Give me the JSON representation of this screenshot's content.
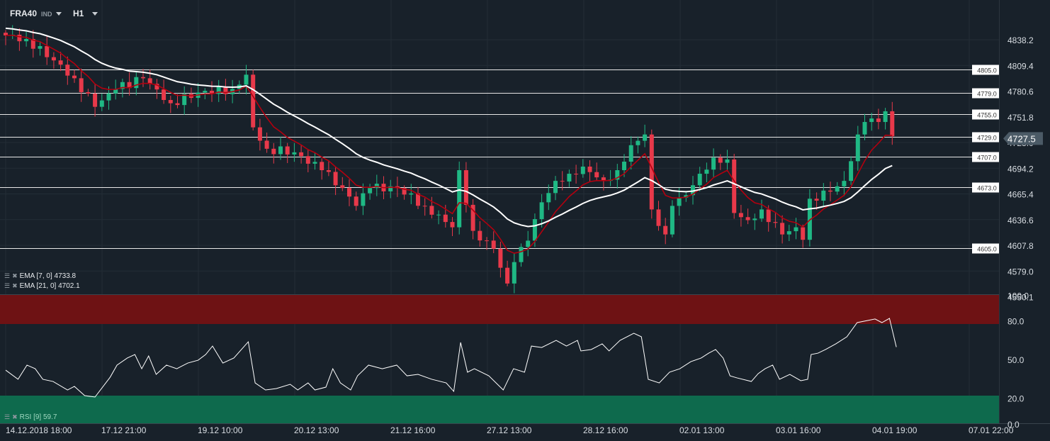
{
  "header": {
    "symbol": "FRA40",
    "type": "IND",
    "timeframe": "H1"
  },
  "indicators": {
    "ema7": "EMA [7, 0] 4733.8",
    "ema21": "EMA [21, 0] 4702.1",
    "rsi": "RSI [9] 59.7"
  },
  "colors": {
    "bg": "#18212a",
    "up": "#1fb884",
    "down": "#e8394a",
    "ema7": "#b3000f",
    "ema21": "#ffffff",
    "overbought": "#6e1214",
    "oversold": "#0e6a4d",
    "grid": "#232d36"
  },
  "chart_data": [
    {
      "type": "candlestick",
      "title": "FRA40 H1",
      "ylim": [
        4550.1,
        4845
      ],
      "y_ticks": [
        "4838.2",
        "4809.4",
        "4780.6",
        "4751.8",
        "4723.0",
        "4694.2",
        "4665.4",
        "4636.6",
        "4607.8",
        "4579.0",
        "4550.1"
      ],
      "x_ticks": [
        "14.12.2018  18:00",
        "17.12  21:00",
        "19.12  10:00",
        "20.12  13:00",
        "21.12  16:00",
        "27.12  13:00",
        "28.12  16:00",
        "02.01  13:00",
        "03.01  16:00",
        "04.01  19:00",
        "07.01  22:00"
      ],
      "current_price": "4727.5",
      "levels": [
        "4805.0",
        "4779.0",
        "4755.0",
        "4729.0",
        "4707.0",
        "4673.0",
        "4605.0"
      ],
      "candle_count": 130,
      "close_anchors": [
        [
          0,
          4843
        ],
        [
          3,
          4839
        ],
        [
          7,
          4815
        ],
        [
          10,
          4795
        ],
        [
          13,
          4763
        ],
        [
          16,
          4783
        ],
        [
          20,
          4795
        ],
        [
          24,
          4767
        ],
        [
          28,
          4779
        ],
        [
          33,
          4783
        ],
        [
          35,
          4799
        ],
        [
          36,
          4740
        ],
        [
          38,
          4716
        ],
        [
          42,
          4712
        ],
        [
          46,
          4692
        ],
        [
          49,
          4672
        ],
        [
          51,
          4652
        ],
        [
          53,
          4672
        ],
        [
          57,
          4672
        ],
        [
          61,
          4652
        ],
        [
          65,
          4628
        ],
        [
          66,
          4692
        ],
        [
          68,
          4624
        ],
        [
          71,
          4604
        ],
        [
          73,
          4565
        ],
        [
          74,
          4589
        ],
        [
          76,
          4613
        ],
        [
          78,
          4656
        ],
        [
          80,
          4680
        ],
        [
          82,
          4688
        ],
        [
          84,
          4696
        ],
        [
          87,
          4680
        ],
        [
          89,
          4692
        ],
        [
          91,
          4720
        ],
        [
          93,
          4732
        ],
        [
          94,
          4648
        ],
        [
          96,
          4620
        ],
        [
          97,
          4652
        ],
        [
          99,
          4664
        ],
        [
          101,
          4688
        ],
        [
          103,
          4706
        ],
        [
          105,
          4704
        ],
        [
          106,
          4644
        ],
        [
          108,
          4636
        ],
        [
          110,
          4648
        ],
        [
          113,
          4620
        ],
        [
          115,
          4628
        ],
        [
          116,
          4614
        ],
        [
          117,
          4660
        ],
        [
          120,
          4668
        ],
        [
          122,
          4680
        ],
        [
          124,
          4732
        ],
        [
          125,
          4746
        ],
        [
          127,
          4746
        ],
        [
          128,
          4758
        ],
        [
          129,
          4730
        ]
      ],
      "series": [
        {
          "name": "EMA 7",
          "period": 7
        },
        {
          "name": "EMA 21",
          "period": 21
        }
      ]
    },
    {
      "type": "line",
      "title": "RSI [9]",
      "ylim": [
        0,
        100
      ],
      "y_ticks": [
        "100.0",
        "80.0",
        "50.0",
        "20.0",
        "0.0"
      ],
      "bands": [
        [
          80,
          100
        ],
        [
          0,
          20
        ]
      ],
      "points": [
        [
          0,
          41.8
        ],
        [
          1.8,
          34.7
        ],
        [
          3.1,
          45.7
        ],
        [
          4.3,
          42.9
        ],
        [
          5.4,
          34.7
        ],
        [
          6.9,
          33.0
        ],
        [
          9,
          26.4
        ],
        [
          10,
          29.2
        ],
        [
          11.5,
          22.0
        ],
        [
          13,
          20.9
        ],
        [
          15.2,
          36.3
        ],
        [
          16.2,
          45.7
        ],
        [
          17.7,
          51.2
        ],
        [
          18.8,
          53.9
        ],
        [
          19.8,
          42.9
        ],
        [
          20.8,
          52.8
        ],
        [
          21.9,
          38.5
        ],
        [
          23.4,
          45.7
        ],
        [
          24.9,
          42.9
        ],
        [
          26.5,
          47.3
        ],
        [
          28,
          49.5
        ],
        [
          29.1,
          53.9
        ],
        [
          30.1,
          60.5
        ],
        [
          31.6,
          47.3
        ],
        [
          33.2,
          51.2
        ],
        [
          35.3,
          63.8
        ],
        [
          36.3,
          31.9
        ],
        [
          37.8,
          26.4
        ],
        [
          39.4,
          27.5
        ],
        [
          41.4,
          30.8
        ],
        [
          42.5,
          26.4
        ],
        [
          44,
          31.9
        ],
        [
          45,
          26.4
        ],
        [
          46.6,
          28.6
        ],
        [
          47.6,
          42.9
        ],
        [
          48.7,
          31.9
        ],
        [
          50.2,
          26.4
        ],
        [
          51.2,
          37.4
        ],
        [
          52.8,
          45.7
        ],
        [
          54.8,
          42.9
        ],
        [
          56.9,
          45.7
        ],
        [
          58.4,
          37.4
        ],
        [
          60,
          38.5
        ],
        [
          62,
          34.7
        ],
        [
          64.1,
          31.9
        ],
        [
          65.2,
          25.3
        ],
        [
          66.2,
          63.3
        ],
        [
          67.2,
          40.2
        ],
        [
          68.2,
          42.9
        ],
        [
          70.3,
          37.4
        ],
        [
          72.4,
          26.4
        ],
        [
          73.9,
          42.9
        ],
        [
          75.5,
          40.2
        ],
        [
          76.5,
          60.5
        ],
        [
          78,
          59.4
        ],
        [
          80.1,
          64.9
        ],
        [
          81.6,
          60.5
        ],
        [
          83.2,
          64.9
        ],
        [
          83.7,
          56.7
        ],
        [
          85.2,
          57.8
        ],
        [
          86.8,
          62.2
        ],
        [
          87.8,
          56.7
        ],
        [
          89.4,
          64.9
        ],
        [
          91.4,
          70.4
        ],
        [
          92.5,
          67.7
        ],
        [
          93.5,
          34.7
        ],
        [
          95.1,
          31.9
        ],
        [
          96.6,
          40.2
        ],
        [
          98.1,
          42.9
        ],
        [
          99.7,
          48.4
        ],
        [
          101.2,
          51.2
        ],
        [
          102.3,
          55.0
        ],
        [
          103.3,
          57.8
        ],
        [
          104.4,
          51.2
        ],
        [
          105.4,
          37.4
        ],
        [
          106.4,
          35.8
        ],
        [
          108.5,
          33.0
        ],
        [
          109.5,
          39.1
        ],
        [
          110.5,
          42.9
        ],
        [
          111.6,
          45.7
        ],
        [
          112.6,
          34.7
        ],
        [
          114.1,
          38.5
        ],
        [
          115.7,
          33.6
        ],
        [
          116.7,
          34.7
        ],
        [
          117.2,
          53.9
        ],
        [
          118.2,
          55.0
        ],
        [
          119.3,
          57.8
        ],
        [
          120.8,
          62.2
        ],
        [
          122.4,
          67.7
        ],
        [
          123.9,
          78.7
        ],
        [
          125.5,
          80.4
        ],
        [
          126.5,
          81.5
        ],
        [
          127.5,
          78.7
        ],
        [
          128.6,
          82.0
        ],
        [
          129.6,
          59.7
        ]
      ]
    }
  ]
}
